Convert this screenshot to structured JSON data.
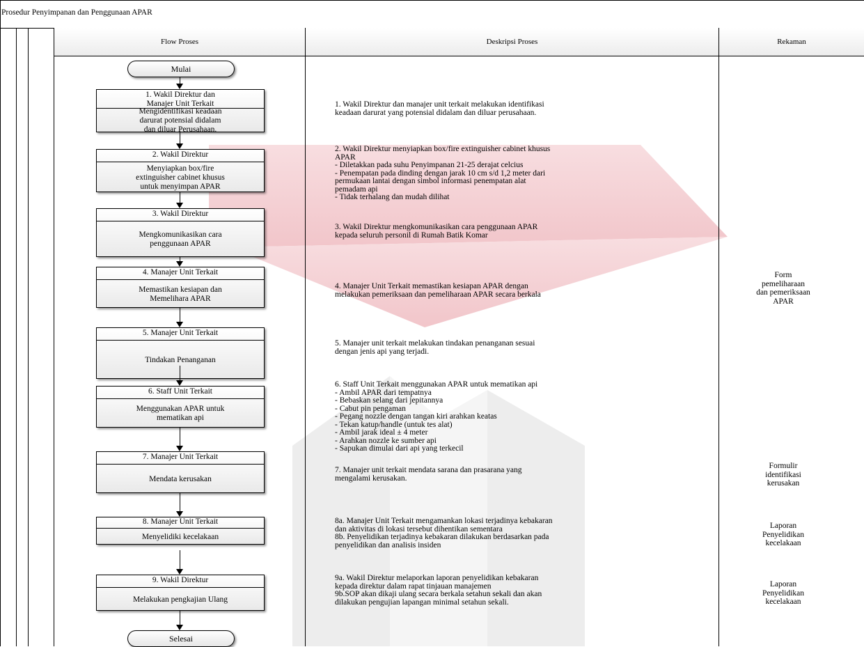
{
  "title": "Prosedur Penyimpanan dan Penggunaan APAR",
  "columns": {
    "flow": "Flow Proses",
    "description": "Deskripsi Proses",
    "record": "Rekaman"
  },
  "start_label": "Mulai",
  "end_label": "Selesai",
  "steps": [
    {
      "head": "1. Wakil Direktur dan\nManajer  Unit Terkait",
      "body": "Mengidentifikasi keadaan\ndarurat potensial didalam\ndan diluar Perusahaan."
    },
    {
      "head": "2. Wakil Direktur",
      "body": "Menyiapkan box/fire\nextinguisher cabinet khusus\nuntuk menyimpan APAR"
    },
    {
      "head": "3. Wakil Direktur",
      "body": "Mengkomunikasikan cara\npenggunaan APAR"
    },
    {
      "head": "4. Manajer  Unit Terkait",
      "body": "Memastikan kesiapan dan\nMemelihara APAR"
    },
    {
      "head": "5. Manajer  Unit Terkait",
      "body": "Tindakan Penanganan"
    },
    {
      "head": "6. Staff Unit Terkait",
      "body": "Menggunakan APAR untuk\nmematikan api"
    },
    {
      "head": "7. Manajer  Unit Terkait",
      "body": "Mendata kerusakan"
    },
    {
      "head": "8. Manajer  Unit Terkait",
      "body": "Menyelidiki kecelakaan"
    },
    {
      "head": "9. Wakil Direktur",
      "body": "Melakukan pengkajian Ulang"
    }
  ],
  "descriptions": [
    "1. Wakil Direktur dan  manajer unit terkait melakukan identifikasi\nkeadaan darurat  yang potensial didalam dan diluar perusahaan.",
    "2. Wakil Direktur menyiapkan box/fire extinguisher cabinet khusus\nAPAR\n- Diletakkan pada  suhu Penyimpanan 21-25 derajat celcius\n- Penempatan  pada dinding dengan jarak 10 cm s/d 1,2 meter dari\npermukaan lantai dengan simbol informasi penempatan alat\npemadam api\n- Tidak terhalang dan mudah dilihat",
    "3. Wakil Direktur mengkomunikasikan cara penggunaan APAR\nkepada seluruh personil di Rumah Batik Komar",
    "4. Manajer  Unit Terkait memastikan kesiapan APAR dengan\nmelakukan pemeriksaan dan pemeliharaan APAR secara berkala",
    "5. Manajer unit terkait melakukan tindakan penanganan sesuai\ndengan jenis api yang terjadi.",
    "6. Staff Unit Terkait menggunakan APAR untuk mematikan api\n- Ambil  APAR dari tempatnya\n- Bebaskan selang dari jepitannya\n- Cabut pin pengaman\n- Pegang nozzle dengan tangan kiri arahkan keatas\n- Tekan katup/handle (untuk tes alat)\n- Ambil jarak  ideal ± 4 meter\n- Arahkan nozzle ke sumber api\n- Sapukan dimulai dari api yang terkecil",
    "7. Manajer unit terkait mendata  sarana dan prasarana yang\nmengalami kerusakan.",
    "8a. Manajer  Unit Terkait mengamankan lokasi terjadinya kebakaran\ndan aktivitas di lokasi tersebut dihentikan sementara\n8b. Penyelidikan terjadinya kebakaran dilakukan berdasarkan pada\npenyelidikan dan analisis insiden",
    "9a. Wakil Direktur melaporkan laporan penyelidikan kebakaran\nkepada direktur dalam rapat tinjauan manajemen\n9b.SOP akan dikaji ulang secara berkala setahun sekali dan akan\ndilakukan pengujian lapangan minimal setahun sekali."
  ],
  "records": [
    "Form\npemeliharaan\ndan pemeriksaan\nAPAR",
    "Formulir\nidentifikasi\nkerusakan",
    "Laporan\nPenyelidikan\nkecelakaan",
    "Laporan\nPenyelidikan\nkecelakaan"
  ],
  "colors": {
    "watermark_red": "#f3c8cc",
    "watermark_gray": "#ececec",
    "header_bottom": "#ececec"
  }
}
